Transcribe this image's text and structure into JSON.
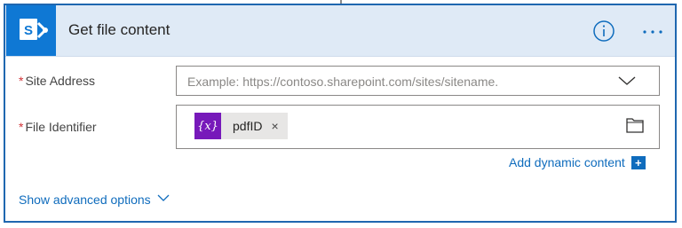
{
  "colors": {
    "accent": "#0f78d4",
    "card_border": "#1f67b0",
    "header_bg": "#dfeaf6",
    "link": "#0f6cbd",
    "token_bg": "#7719ba",
    "required": "#d13438"
  },
  "header": {
    "app_icon": "sharepoint-icon",
    "title": "Get file content",
    "info_icon": "info-icon",
    "more_icon": "ellipsis-icon"
  },
  "fields": {
    "site_address": {
      "required_mark": "*",
      "label": "Site Address",
      "placeholder": "Example: https://contoso.sharepoint.com/sites/sitename.",
      "dropdown_icon": "chevron-down-icon"
    },
    "file_identifier": {
      "required_mark": "*",
      "label": "File Identifier",
      "token": {
        "icon_text": "{x}",
        "label": "pdfID",
        "remove": "×"
      },
      "picker_icon": "folder-icon"
    }
  },
  "add_dynamic_content": {
    "label": "Add dynamic content",
    "badge": "+"
  },
  "advanced_options": {
    "label": "Show advanced options",
    "icon": "chevron-down-icon"
  }
}
